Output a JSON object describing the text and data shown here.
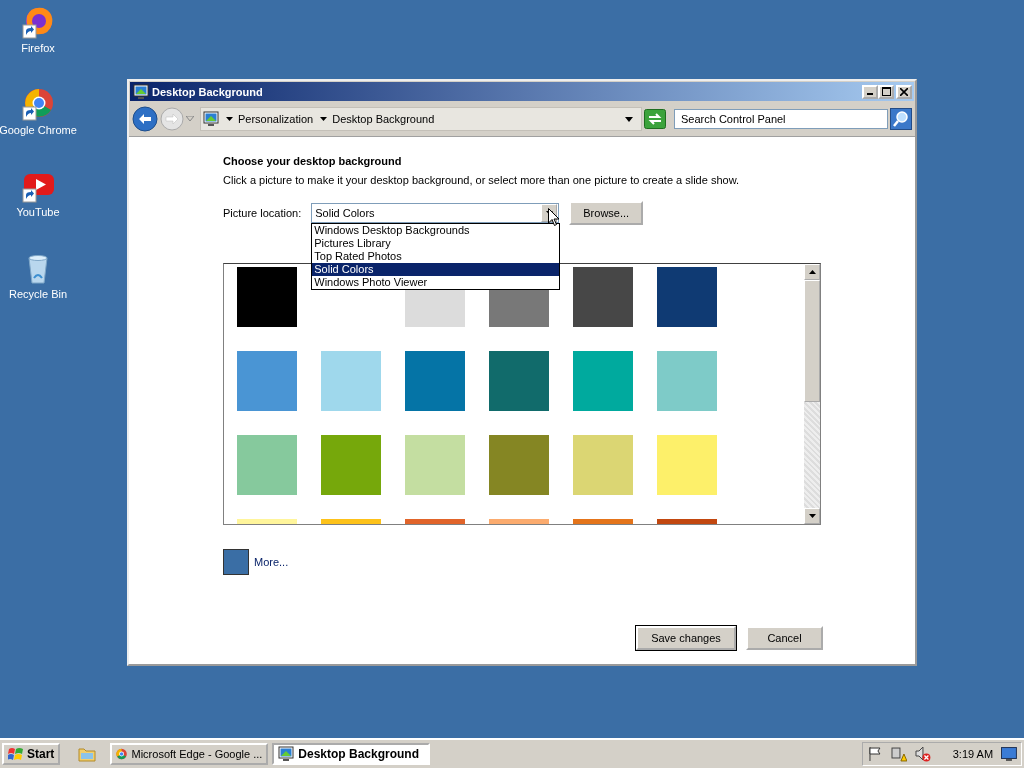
{
  "desktop_icons": [
    {
      "label": "Firefox",
      "kind": "firefox"
    },
    {
      "label": "Google Chrome",
      "kind": "chrome"
    },
    {
      "label": "YouTube",
      "kind": "youtube"
    },
    {
      "label": "Recycle Bin",
      "kind": "recycle"
    }
  ],
  "window": {
    "title": "Desktop Background",
    "address": {
      "breadcrumbs": [
        "Personalization",
        "Desktop Background"
      ],
      "search": {
        "placeholder": "Search Control Panel"
      }
    },
    "heading": "Choose your desktop background",
    "description": "Click a picture to make it your desktop background, or select more than one picture to create a slide show.",
    "picture_location": {
      "label": "Picture location:",
      "value": "Solid Colors",
      "expanded": true,
      "options": [
        {
          "label": "Windows Desktop Backgrounds",
          "selected": false
        },
        {
          "label": "Pictures Library",
          "selected": false
        },
        {
          "label": "Top Rated Photos",
          "selected": false
        },
        {
          "label": "Solid Colors",
          "selected": true
        },
        {
          "label": "Windows Photo Viewer",
          "selected": false
        }
      ]
    },
    "browse_button": "Browse...",
    "swatches": [
      {
        "color": "#000000"
      },
      {
        "color": "#dcdcdc"
      },
      {
        "color": "#787878"
      },
      {
        "color": "#474747"
      },
      {
        "color": "#0f3a73"
      },
      {
        "color": "#4a95d4"
      },
      {
        "color": "#9fd8ec"
      },
      {
        "color": "#0574a6"
      },
      {
        "color": "#116b6b"
      },
      {
        "color": "#00aa9e"
      },
      {
        "color": "#7ecbc8"
      },
      {
        "color": "#86c99d"
      },
      {
        "color": "#76a80b"
      },
      {
        "color": "#c4dea1"
      },
      {
        "color": "#858623"
      },
      {
        "color": "#dbd673"
      },
      {
        "color": "#fdf06a"
      },
      {
        "color": "#fff59b"
      },
      {
        "color": "#fdc21a"
      },
      {
        "color": "#e1642a"
      },
      {
        "color": "#fbab6e"
      },
      {
        "color": "#e4741a"
      },
      {
        "color": "#c2470f"
      }
    ],
    "more": {
      "color": "#3a6ea5",
      "label": "More..."
    },
    "buttons": [
      {
        "label": "Save changes",
        "default": true
      },
      {
        "label": "Cancel",
        "default": false
      }
    ]
  },
  "taskbar": {
    "start": "Start",
    "tasks": [
      {
        "label": "Microsoft Edge - Google ...",
        "kind": "chrome",
        "selected": false
      },
      {
        "label": "Desktop Background",
        "kind": "monitor",
        "selected": true
      }
    ],
    "clock": "3:19 AM"
  }
}
